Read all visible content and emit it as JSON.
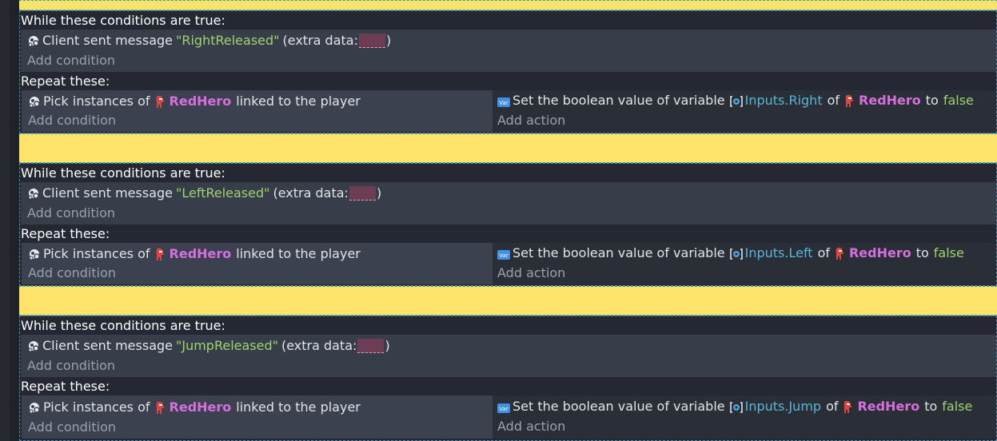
{
  "labels": {
    "while": "While these conditions are true:",
    "repeat": "Repeat these:",
    "add_condition": "Add condition",
    "add_action": "Add action",
    "client_sent": "Client sent message",
    "extra_open": "(extra data:",
    "extra_close": ")",
    "pick": "Pick instances of",
    "linked": "linked to the player",
    "set_bool": "Set the boolean value of variable",
    "of": "of",
    "to": "to"
  },
  "events": [
    {
      "message": "\"RightReleased\"",
      "object": "RedHero",
      "variable": "Inputs.Right",
      "value": "false"
    },
    {
      "message": "\"LeftReleased\"",
      "object": "RedHero",
      "variable": "Inputs.Left",
      "value": "false"
    },
    {
      "message": "\"JumpReleased\"",
      "object": "RedHero",
      "variable": "Inputs.Jump",
      "value": "false"
    }
  ],
  "icons": {
    "network": "network-icon",
    "hero": "red-hero-icon",
    "variable": "var-badge-icon",
    "scene_var": "variable-icon"
  },
  "colors": {
    "separator": "#fee46a",
    "string": "#9ed46f",
    "object": "#d66fdd",
    "variable": "#58b6d9"
  }
}
